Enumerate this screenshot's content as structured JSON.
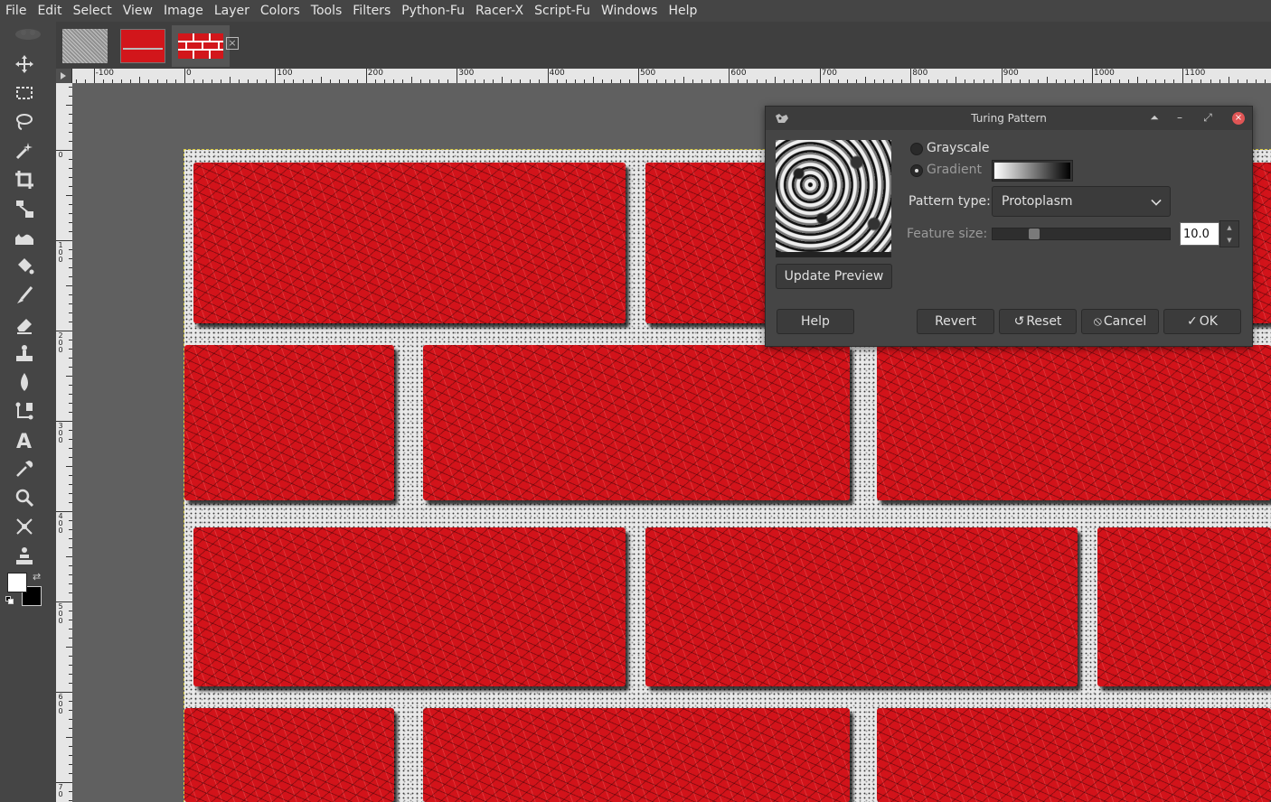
{
  "menubar": {
    "items": [
      "File",
      "Edit",
      "Select",
      "View",
      "Image",
      "Layer",
      "Colors",
      "Tools",
      "Filters",
      "Python-Fu",
      "Racer-X",
      "Script-Fu",
      "Windows",
      "Help"
    ]
  },
  "toolbox": {
    "tools": [
      "move-tool-icon",
      "rect-select-icon",
      "lasso-icon",
      "fuzzy-select-icon",
      "crop-icon",
      "transform-icon",
      "warp-icon",
      "bucket-fill-icon",
      "paintbrush-icon",
      "eraser-icon",
      "clone-icon",
      "blur-icon",
      "paths-icon",
      "text-icon",
      "color-picker-icon",
      "zoom-icon",
      "measure-icon",
      "align-icon"
    ],
    "foreground_color": "#ffffff",
    "background_color": "#000000"
  },
  "image_tabs": [
    "noise-pattern",
    "red-fill",
    "brick-wall"
  ],
  "rulers": {
    "horizontal_labels": [
      "-100",
      "0",
      "100",
      "200",
      "300",
      "400",
      "500",
      "600",
      "700",
      "800",
      "900",
      "1000",
      "1100"
    ],
    "vertical_labels": [
      "0",
      "1\n0\n0",
      "2\n0\n0",
      "3\n0\n0",
      "4\n0\n0",
      "5\n0\n0",
      "6\n0\n0",
      "7\n0"
    ]
  },
  "colors": {
    "brick": "#d2131a",
    "mortar": "#e8e8e8",
    "canvas_bg": "#606060",
    "selection_outline": "#d9cc43"
  },
  "dialog": {
    "title": "Turing Pattern",
    "update_preview_label": "Update Preview",
    "options": {
      "grayscale_label": "Grayscale",
      "gradient_label": "Gradient",
      "selected": "Gradient"
    },
    "pattern_type_label": "Pattern type:",
    "pattern_type_value": "Protoplasm",
    "feature_size_label": "Feature size:",
    "feature_size_value": "10.0",
    "feature_size_fraction": 0.22,
    "buttons": {
      "help": "Help",
      "revert": "Revert",
      "reset": "Reset",
      "cancel": "Cancel",
      "ok": "OK"
    }
  }
}
